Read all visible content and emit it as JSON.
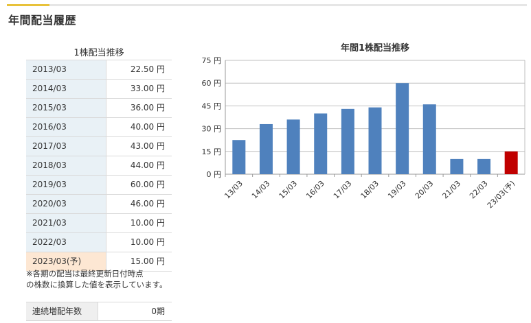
{
  "section": {
    "title": "年間配当履歴"
  },
  "table": {
    "caption": "1株配当推移",
    "rows": [
      {
        "year": "2013/03",
        "value": "22.50 円"
      },
      {
        "year": "2014/03",
        "value": "33.00 円"
      },
      {
        "year": "2015/03",
        "value": "36.00 円"
      },
      {
        "year": "2016/03",
        "value": "40.00 円"
      },
      {
        "year": "2017/03",
        "value": "43.00 円"
      },
      {
        "year": "2018/03",
        "value": "44.00 円"
      },
      {
        "year": "2019/03",
        "value": "60.00 円"
      },
      {
        "year": "2020/03",
        "value": "46.00 円"
      },
      {
        "year": "2021/03",
        "value": "10.00 円"
      },
      {
        "year": "2022/03",
        "value": "10.00 円"
      },
      {
        "year": "2023/03(予)",
        "value": "15.00 円"
      }
    ]
  },
  "note": {
    "line1": "※各期の配当は最終更新日付時点",
    "line2": "の株数に換算した値を表示しています。"
  },
  "streak": {
    "label": "連続増配年数",
    "value": "0期"
  },
  "colors": {
    "bar": "#4f81bd",
    "forecast_bar": "#c00000",
    "accent": "#e8c23a"
  },
  "chart_data": {
    "type": "bar",
    "title": "年間1株配当推移",
    "categories": [
      "13/03",
      "14/03",
      "15/03",
      "16/03",
      "17/03",
      "18/03",
      "19/03",
      "20/03",
      "21/03",
      "22/03",
      "23/03(予)"
    ],
    "values": [
      22.5,
      33,
      36,
      40,
      43,
      44,
      60,
      46,
      10,
      10,
      15
    ],
    "forecast_index": 10,
    "ylim": [
      0,
      75
    ],
    "yticks": [
      "0 円",
      "15 円",
      "30 円",
      "45 円",
      "60 円",
      "75 円"
    ],
    "grid": true
  }
}
